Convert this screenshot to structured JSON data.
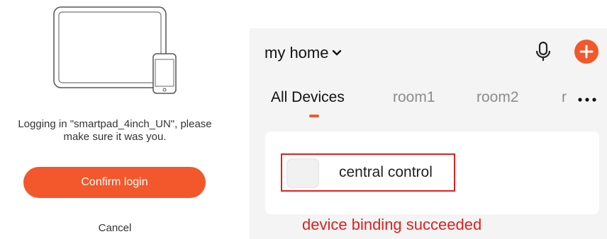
{
  "login": {
    "message_line1": "Logging in \"smartpad_4inch_UN\", please",
    "message_line2": "make sure it was you.",
    "confirm_label": "Confirm login",
    "cancel_label": "Cancel",
    "accent_color": "#f2582b"
  },
  "home": {
    "title": "my home",
    "icons": [
      "chevron-down-icon",
      "microphone-icon",
      "add-icon",
      "more-icon"
    ]
  },
  "tabs": [
    {
      "label": "All Devices",
      "active": true
    },
    {
      "label": "room1",
      "active": false
    },
    {
      "label": "room2",
      "active": false
    },
    {
      "label": "r",
      "active": false
    }
  ],
  "device": {
    "name": "central control"
  },
  "annotation": {
    "caption": "device binding succeeded",
    "color": "#e02020"
  }
}
